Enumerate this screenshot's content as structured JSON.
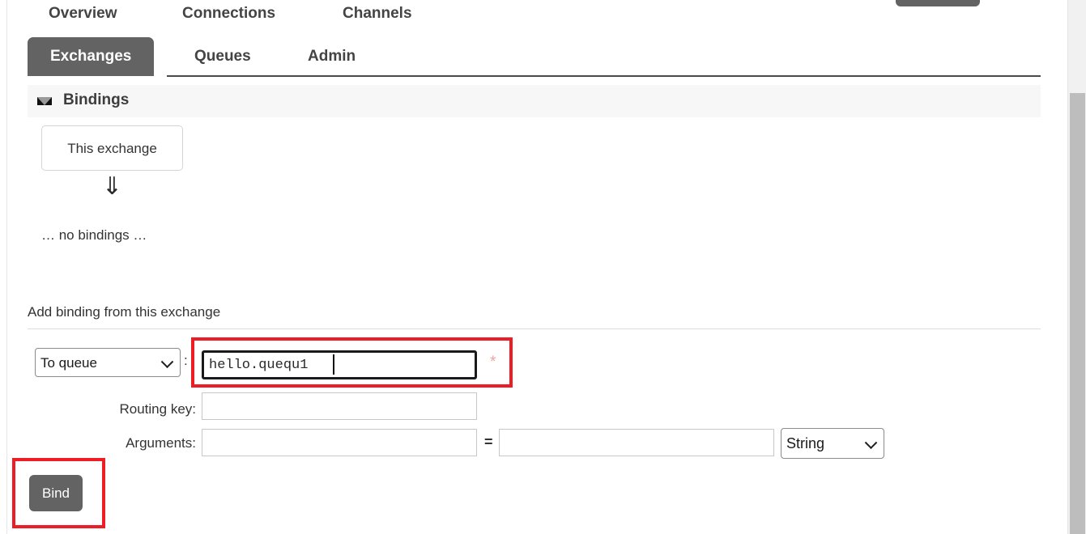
{
  "nav": {
    "primary": [
      {
        "label": "Overview"
      },
      {
        "label": "Connections"
      },
      {
        "label": "Channels"
      }
    ],
    "secondary": [
      {
        "label": "Exchanges",
        "selected": true
      },
      {
        "label": "Queues",
        "selected": false
      },
      {
        "label": "Admin",
        "selected": false
      }
    ]
  },
  "bindings_section": {
    "title": "Bindings",
    "caret_icon": "triangle-down-icon",
    "source_box_label": "This exchange",
    "flow_arrow": "⇓",
    "empty_text": "… no bindings …"
  },
  "add_binding": {
    "title": "Add binding from this exchange",
    "destination": {
      "select_value": "To queue",
      "separator": ":",
      "input_value": "hello.quequ1",
      "required_marker": "*",
      "highlighted": true
    },
    "routing_key": {
      "label": "Routing key:",
      "value": "",
      "placeholder": ""
    },
    "arguments": {
      "label": "Arguments:",
      "key_value": "",
      "equals": "=",
      "value_value": "",
      "type_value": "String"
    },
    "submit_label": "Bind",
    "submit_highlighted": true
  },
  "colors": {
    "highlight_red": "#ee1c25",
    "tab_selected_bg": "#636363",
    "button_bg": "#636363",
    "section_header_bg": "#f7f7f7",
    "required_star": "#f4a0a0",
    "scrollbar_thumb": "#bdbdbd"
  }
}
